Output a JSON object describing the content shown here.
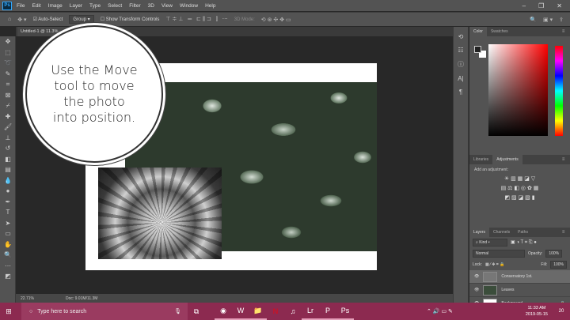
{
  "menubar": {
    "logo": "Ps",
    "items": [
      "File",
      "Edit",
      "Image",
      "Layer",
      "Type",
      "Select",
      "Filter",
      "3D",
      "View",
      "Window",
      "Help"
    ]
  },
  "options": {
    "auto_select": "Auto-Select",
    "group": "Group",
    "show_transform": "Show Transform Controls",
    "mode_3d": "3D Mode:"
  },
  "document": {
    "tab": "Untitled-1 @ 11.3%"
  },
  "callout": {
    "text": "Use the Move tool to move the photo into position."
  },
  "status": {
    "zoom": "22.71%",
    "doc": "Doc: 9.01M/11.3M"
  },
  "color_panel": {
    "tabs": [
      "Color",
      "Swatches"
    ]
  },
  "adjustments": {
    "tabs": [
      "Libraries",
      "Adjustments"
    ],
    "label": "Add an adjustment:"
  },
  "layers": {
    "tabs": [
      "Layers",
      "Channels",
      "Paths"
    ],
    "kind": "Kind",
    "blend": "Normal",
    "opacity_label": "Opacity:",
    "opacity": "100%",
    "lock_label": "Lock:",
    "fill_label": "Fill:",
    "fill": "100%",
    "items": [
      {
        "name": "Conservatory 1st."
      },
      {
        "name": "Leaves"
      },
      {
        "name": "Background"
      }
    ]
  },
  "taskbar": {
    "search_placeholder": "Type here to search",
    "time": "11:33 AM",
    "date": "2019-05-15",
    "notifications": "20"
  }
}
